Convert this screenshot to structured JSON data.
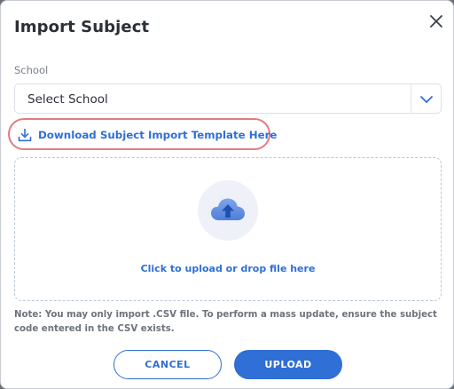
{
  "modal": {
    "title": "Import Subject",
    "close_icon": "close-icon"
  },
  "school_field": {
    "label": "School",
    "value": "Select School",
    "chevron_icon": "chevron-down-icon"
  },
  "download_link": {
    "icon": "download-icon",
    "label": "Download Subject Import Template Here",
    "highlight_color": "#e37b80"
  },
  "dropzone": {
    "icon": "cloud-upload-icon",
    "label": "Click to upload or drop file here"
  },
  "note": "Note: You may only import .CSV file. To perform a mass update, ensure the subject code entered in the CSV exists.",
  "footer": {
    "cancel_label": "CANCEL",
    "upload_label": "UPLOAD"
  },
  "colors": {
    "accent": "#2f6fd6",
    "text": "#2b2f36",
    "muted": "#7a8089"
  }
}
